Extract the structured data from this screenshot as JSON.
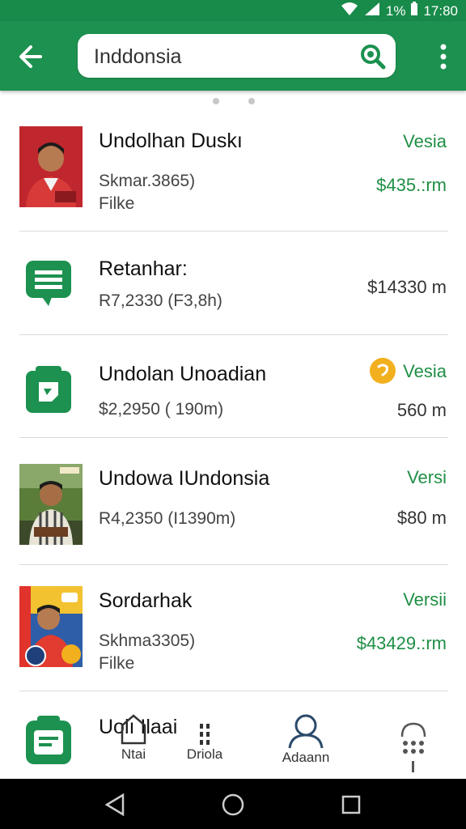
{
  "status": {
    "battery_percent": "1%",
    "time": "17:80"
  },
  "header": {
    "search": {
      "value": "Inddonsia",
      "placeholder": "Inddonsia"
    }
  },
  "list": [
    {
      "title": "Undolhan Duskı",
      "sub1": "Skmar.3865)",
      "sub2": "Filke",
      "tag": "Vesia",
      "price": "$435.:rm",
      "image": "portrait-red"
    },
    {
      "title": "Retanhar:",
      "sub1": "R7,2330 (F3,8h)",
      "price": "$14330 m",
      "icon": "chat-icon"
    },
    {
      "title": "Undolan Unoadian",
      "sub1": "$2,2950  ( 190m)",
      "tag": "Vesia",
      "price": "560 m",
      "icon": "store-icon",
      "badge": "coin-icon"
    },
    {
      "title": "Undowa IUndonsia",
      "sub1": "R4,2350 (I1390m)",
      "tag": "Versi",
      "price": "$80 m",
      "image": "portrait-outdoor"
    },
    {
      "title": "Sordarhak",
      "sub1": "Skhma3305)",
      "sub2": "Filke",
      "tag": "Versii",
      "price": "$43429.:rm",
      "image": "portrait-poster"
    },
    {
      "title": "Uolı Ilaai",
      "icon": "wallet-icon"
    }
  ],
  "bottom_nav": [
    {
      "label": "Ntai",
      "icon": "home-icon"
    },
    {
      "label": "Driola",
      "icon": "grid-icon"
    },
    {
      "label": "Adaann",
      "icon": "person-icon"
    },
    {
      "label": "",
      "icon": "cloud-icon"
    }
  ],
  "colors": {
    "primary": "#1d9150",
    "price_green": "#1f8f45",
    "badge_yellow": "#f2b01e"
  }
}
